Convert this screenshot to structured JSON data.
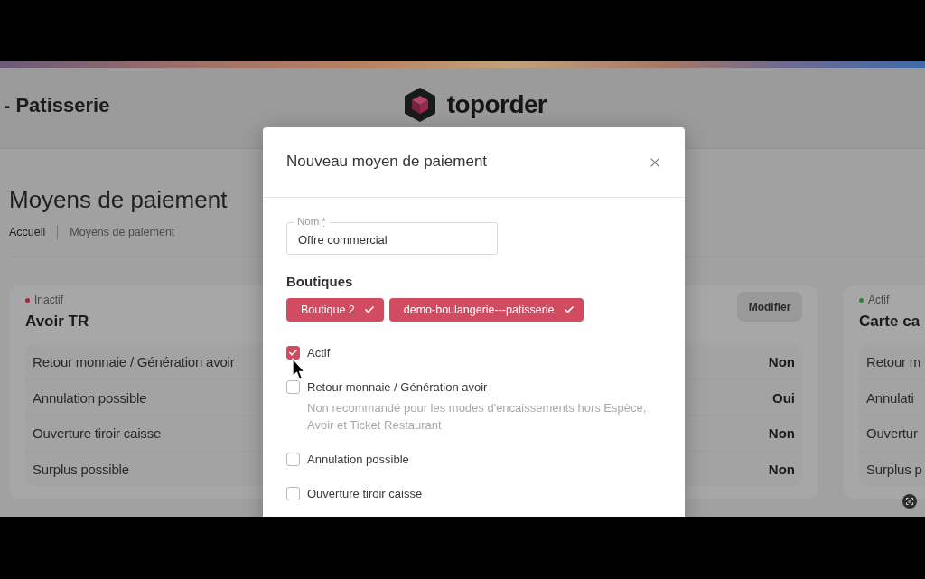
{
  "header": {
    "title": "- Patisserie",
    "logo_text": "toporder"
  },
  "page": {
    "title": "Moyens de paiement",
    "breadcrumb": [
      {
        "label": "Accueil",
        "current": false
      },
      {
        "label": "Moyens de paiement",
        "current": true
      }
    ]
  },
  "cards": [
    {
      "status": "Inactif",
      "color": "#a3283c",
      "title": "Avoir TR",
      "action": "Modifier",
      "rows": [
        {
          "label": "Retour monnaie / Génération avoir",
          "value": "Non"
        },
        {
          "label": "Annulation possible",
          "value": "Oui"
        },
        {
          "label": "Ouverture tiroir caisse",
          "value": "Non"
        },
        {
          "label": "Surplus possible",
          "value": "Non"
        }
      ]
    },
    {
      "status": "Actif",
      "color": "#2f7f3a",
      "title": "Carte ca",
      "rows": [
        {
          "label": "Retour m"
        },
        {
          "label": "Annulati"
        },
        {
          "label": "Ouvertur"
        },
        {
          "label": "Surplus p"
        }
      ]
    }
  ],
  "modal": {
    "title": "Nouveau moyen de paiement",
    "name_field": {
      "label": "Nom",
      "required_mark": "*",
      "value": "Offre commercial"
    },
    "shops_label": "Boutiques",
    "shops": [
      {
        "label": "Boutique 2",
        "selected": true
      },
      {
        "label": "demo-boulangerie---patisserie",
        "selected": true
      }
    ],
    "options": [
      {
        "label": "Actif",
        "checked": true
      },
      {
        "label": "Retour monnaie / Génération avoir",
        "checked": false,
        "hint": "Non recommandé pour les modes d'encaissements hors Espèce, Avoir et Ticket Restaurant"
      },
      {
        "label": "Annulation possible",
        "checked": false
      },
      {
        "label": "Ouverture tiroir caisse",
        "checked": false
      }
    ]
  }
}
